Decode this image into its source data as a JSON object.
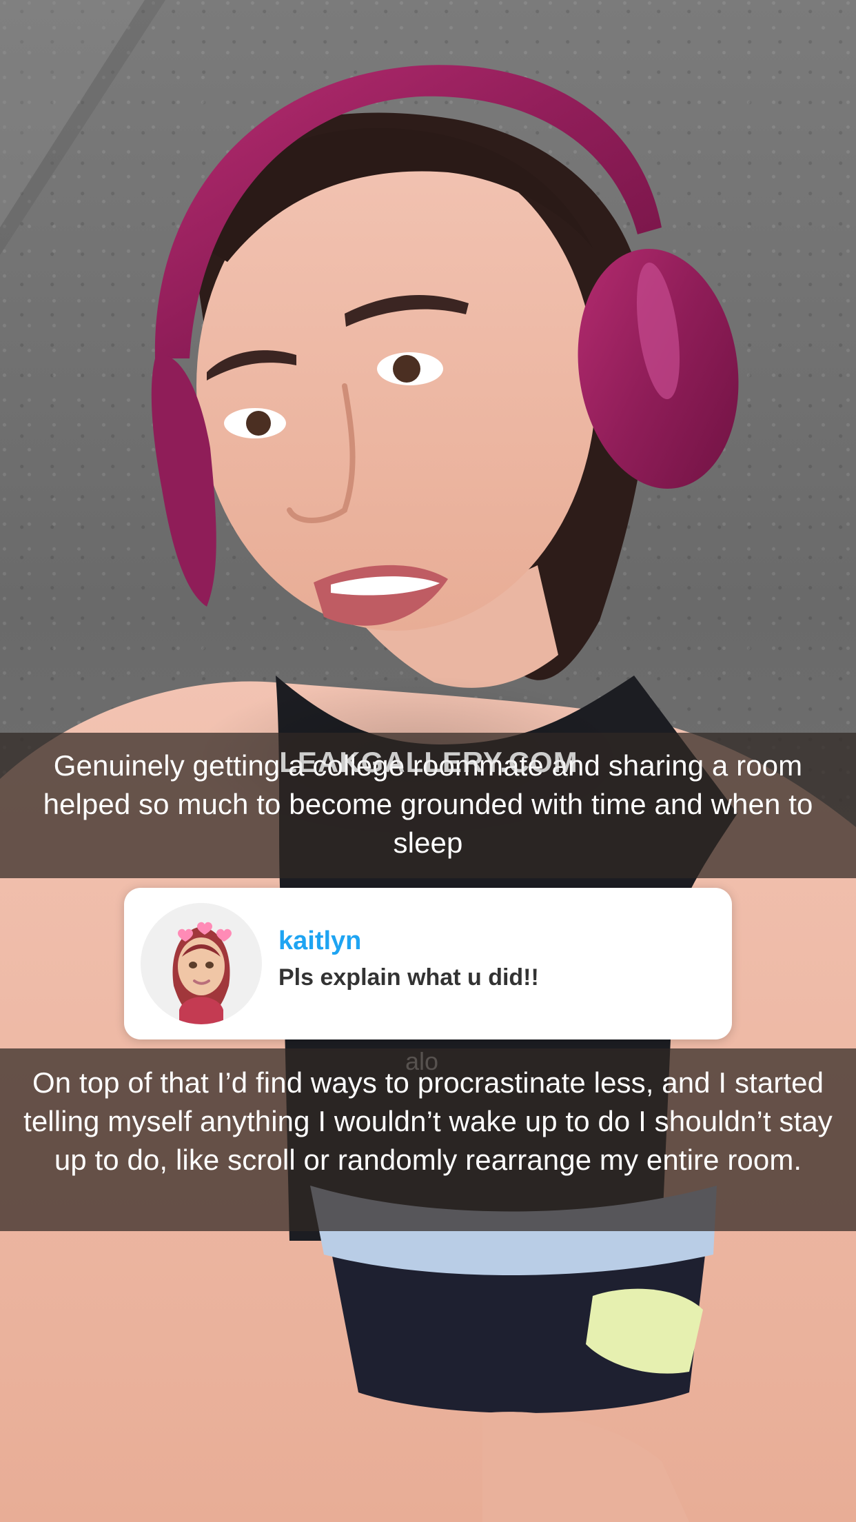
{
  "captions": {
    "top": "Genuinely getting a college roommate and sharing a room helped so much to become grounded with time and when to sleep",
    "bottom": "On top of that I’d find ways to procrastinate less, and I started telling myself anything I wouldn’t wake up to do I shouldn’t stay up to do, like scroll or randomly rearrange my entire room."
  },
  "reply": {
    "username": "kaitlyn",
    "message": "Pls explain what u did!!"
  },
  "overlay": {
    "watermark": "LEAKGALLERY.COM",
    "shirt_logo": "alo"
  },
  "colors": {
    "username": "#1ea4f2",
    "caption_background": "#30282448",
    "headphones": "#8f1d58"
  }
}
